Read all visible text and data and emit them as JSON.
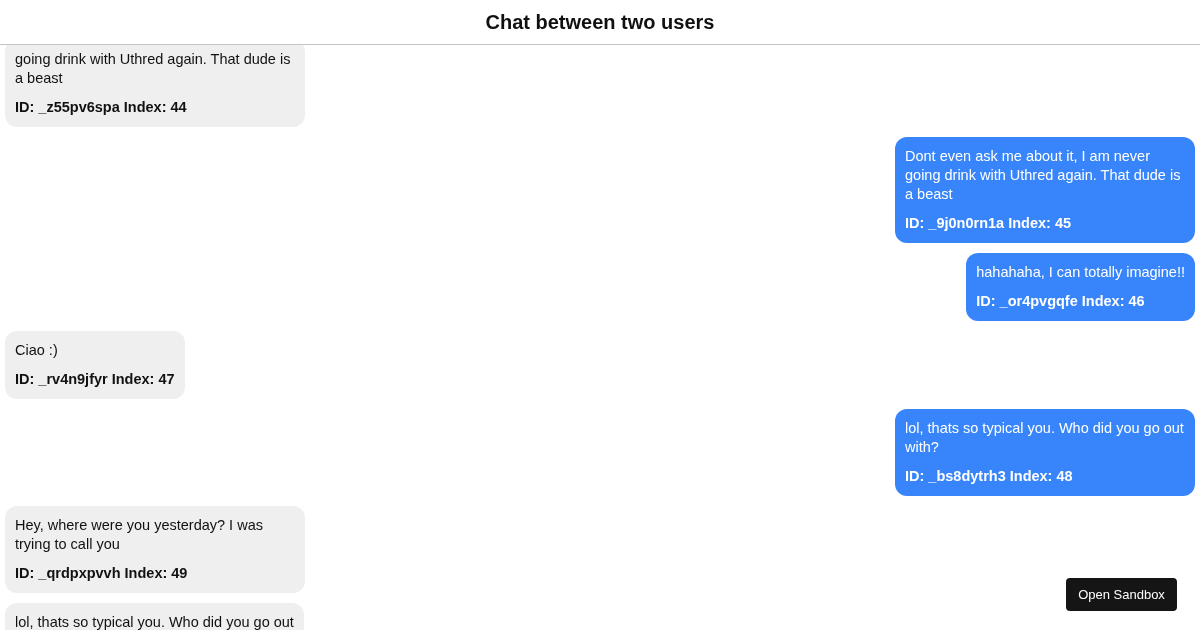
{
  "header": {
    "title": "Chat between two users"
  },
  "messages": [
    {
      "kind": "incoming",
      "text": "going drink with Uthred again. That dude is a beast",
      "meta": "ID: _z55pv6spa Index: 44"
    },
    {
      "kind": "outgoing",
      "text": "Dont even ask me about it, I am never going drink with Uthred again. That dude is a beast",
      "meta": "ID: _9j0n0rn1a Index: 45"
    },
    {
      "kind": "outgoing",
      "text": "hahahaha, I can totally imagine!!",
      "meta": "ID: _or4pvgqfe Index: 46"
    },
    {
      "kind": "incoming",
      "text": "Ciao :)",
      "meta": "ID: _rv4n9jfyr Index: 47"
    },
    {
      "kind": "outgoing",
      "text": "lol, thats so typical you. Who did you go out with?",
      "meta": "ID: _bs8dytrh3 Index: 48"
    },
    {
      "kind": "incoming",
      "text": "Hey, where were you yesterday? I was trying to call you",
      "meta": "ID: _qrdpxpvvh Index: 49"
    },
    {
      "kind": "incoming",
      "text": "lol, thats so typical you. Who did you go out"
    }
  ],
  "sandbox_button": {
    "label": "Open Sandbox"
  }
}
